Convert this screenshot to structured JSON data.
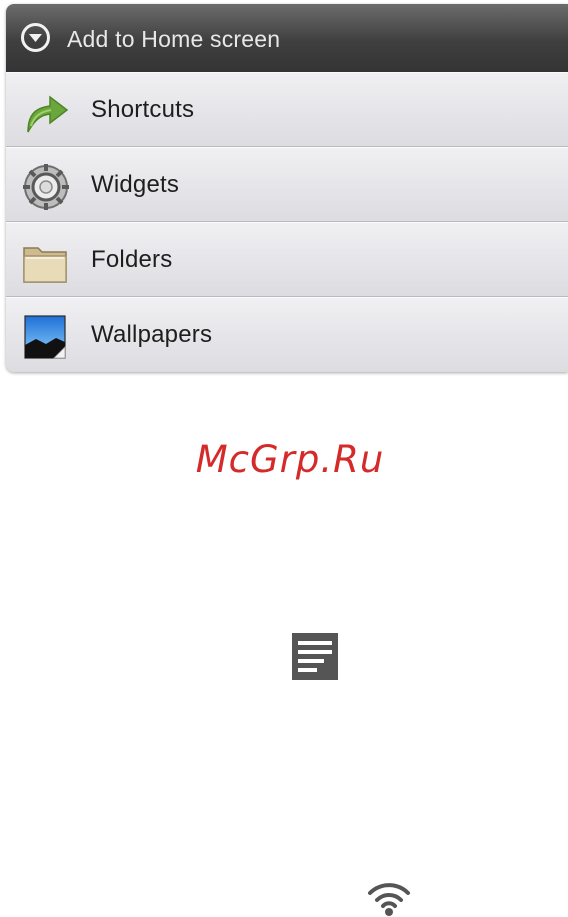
{
  "dialog": {
    "title": "Add to Home screen",
    "items": [
      {
        "label": "Shortcuts",
        "icon": "shortcut-arrow-icon"
      },
      {
        "label": "Widgets",
        "icon": "widget-gear-icon"
      },
      {
        "label": "Folders",
        "icon": "folder-icon"
      },
      {
        "label": "Wallpapers",
        "icon": "wallpaper-icon"
      }
    ]
  },
  "watermark": "McGrp.Ru",
  "colors": {
    "header": "#3f3f3f",
    "watermark": "#d42a2a",
    "accent_arrow": "#6aa63c"
  },
  "icons": [
    "menu-key-icon",
    "wifi-icon"
  ]
}
